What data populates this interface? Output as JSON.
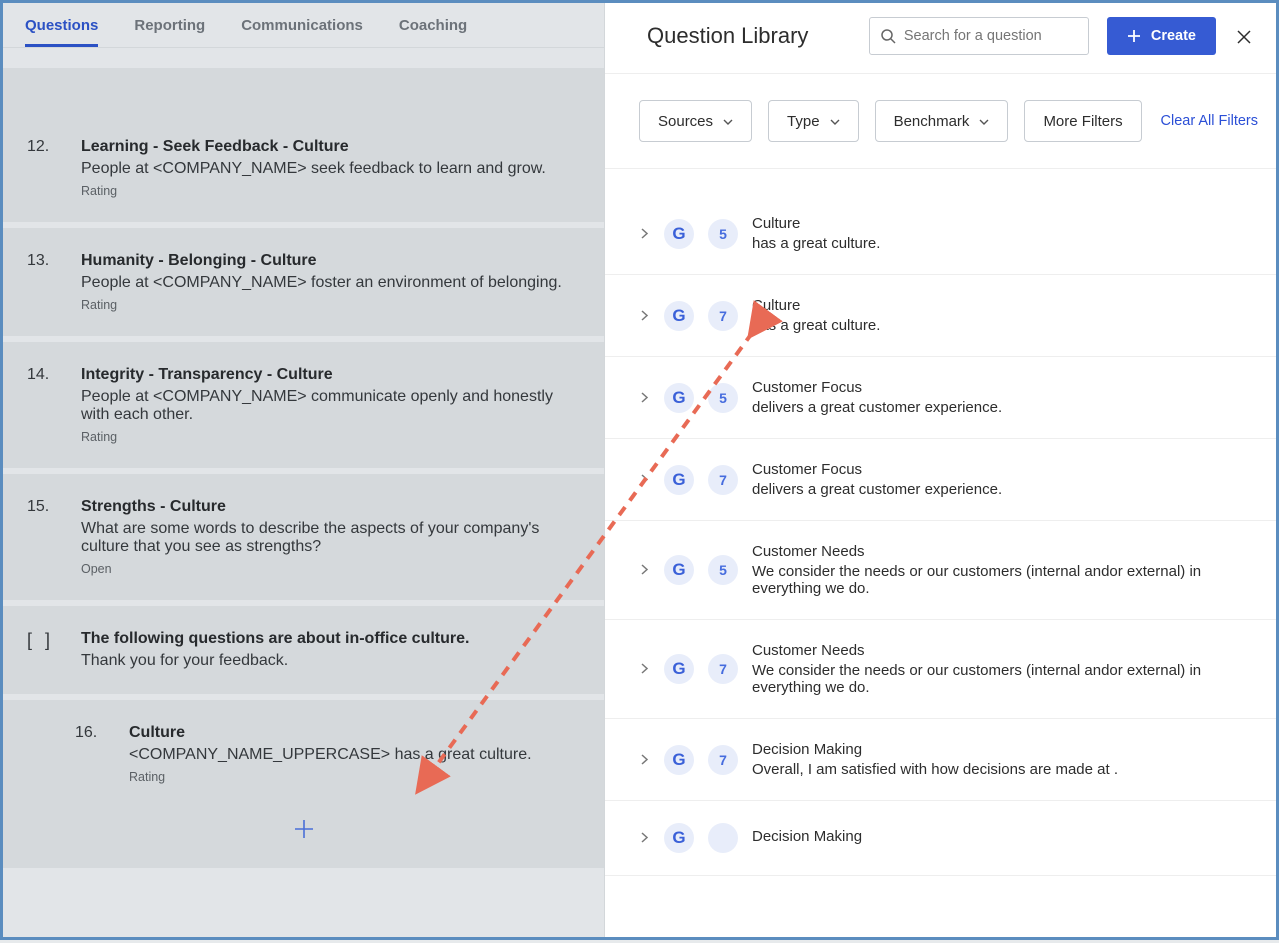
{
  "tabs": {
    "questions": "Questions",
    "reporting": "Reporting",
    "communications": "Communications",
    "coaching": "Coaching"
  },
  "questions": [
    {
      "num": "12.",
      "title": "Learning - Seek Feedback - Culture",
      "desc": "People at <COMPANY_NAME> seek feedback to learn and grow.",
      "type": "Rating"
    },
    {
      "num": "13.",
      "title": "Humanity - Belonging - Culture",
      "desc": "People at <COMPANY_NAME> foster an environment of belonging.",
      "type": "Rating"
    },
    {
      "num": "14.",
      "title": "Integrity - Transparency - Culture",
      "desc": "People at <COMPANY_NAME> communicate openly and honestly with each other.",
      "type": "Rating"
    },
    {
      "num": "15.",
      "title": "Strengths - Culture",
      "desc": "What are some words to describe the aspects of your company's culture that you see as strengths?",
      "type": "Open"
    }
  ],
  "section": {
    "marker": "[ ]",
    "title": "The following questions are about in-office culture.",
    "sub": "Thank you for your feedback."
  },
  "question16": {
    "num": "16.",
    "title": "Culture",
    "desc": "<COMPANY_NAME_UPPERCASE> has a great culture.",
    "type": "Rating"
  },
  "library": {
    "title": "Question Library",
    "search_placeholder": "Search for a question",
    "create": "Create",
    "filters": {
      "sources": "Sources",
      "type": "Type",
      "benchmark": "Benchmark",
      "more": "More Filters",
      "clear": "Clear All Filters"
    },
    "items": [
      {
        "num": "5",
        "cat": "Culture",
        "desc": "<COMPANY_NAME_UPPERCASE> has a great culture."
      },
      {
        "num": "7",
        "cat": "Culture",
        "desc": "<COMPANY_NAME_UPPERCASE> has a great culture."
      },
      {
        "num": "5",
        "cat": "Customer Focus",
        "desc": "<COMPANY_NAME_UPPERCASE> delivers a great customer experience."
      },
      {
        "num": "7",
        "cat": "Customer Focus",
        "desc": "<COMPANY_NAME_UPPERCASE> delivers a great customer experience."
      },
      {
        "num": "5",
        "cat": "Customer Needs",
        "desc": "We consider the needs or our customers (internal andor external) in everything we do."
      },
      {
        "num": "7",
        "cat": "Customer Needs",
        "desc": "We consider the needs or our customers (internal andor external) in everything we do."
      },
      {
        "num": "7",
        "cat": "Decision Making",
        "desc": "Overall, I am satisfied with how decisions are made at <COMPANY_NAME>."
      },
      {
        "num": "",
        "cat": "Decision Making",
        "desc": ""
      }
    ]
  }
}
